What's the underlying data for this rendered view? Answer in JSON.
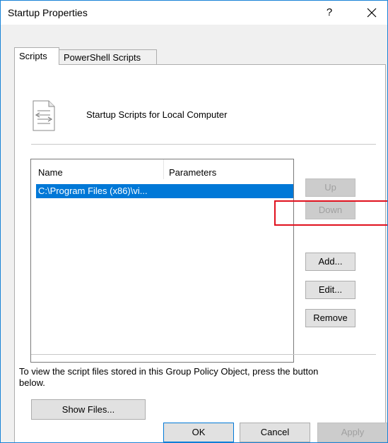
{
  "window": {
    "title": "Startup Properties",
    "help_label": "?"
  },
  "tabs": [
    {
      "label": "Scripts",
      "active": true
    },
    {
      "label": "PowerShell Scripts",
      "active": false
    }
  ],
  "header": {
    "icon": "script-file-icon",
    "text": "Startup Scripts for Local Computer"
  },
  "script_list": {
    "columns": [
      "Name",
      "Parameters"
    ],
    "rows": [
      {
        "name": "C:\\Program Files (x86)\\vi...",
        "parameters": "",
        "selected": true
      }
    ]
  },
  "side_buttons": {
    "up": "Up",
    "down": "Down",
    "add": "Add...",
    "edit": "Edit...",
    "remove": "Remove"
  },
  "info": {
    "text": "To view the script files stored in this Group Policy Object, press the button below.",
    "show_files": "Show Files..."
  },
  "footer": {
    "ok": "OK",
    "cancel": "Cancel",
    "apply": "Apply"
  },
  "colors": {
    "accent": "#0078d7",
    "annotation": "#e0101d"
  }
}
